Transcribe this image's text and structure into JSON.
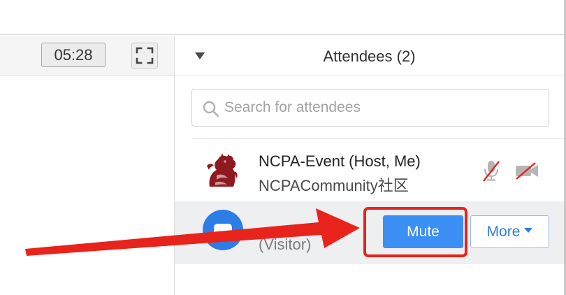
{
  "toolbar": {
    "timer": "05:28",
    "fullscreen_icon": "fullscreen-icon"
  },
  "attendees": {
    "collapse_icon": "triangle-down-icon",
    "title": "Attendees (2)",
    "search": {
      "placeholder": "Search for attendees",
      "value": "",
      "icon": "search-icon"
    },
    "list": [
      {
        "name": "NCPA-Event (Host, Me)",
        "subtitle": "NCPACommunity社区",
        "avatar": "dragon-avatar",
        "mic": "mic-muted-icon",
        "camera": "camera-off-icon"
      },
      {
        "name": "(Visitor)",
        "avatar": "blue-avatar",
        "actions": {
          "mute_label": "Mute",
          "more_label": "More",
          "more_icon": "caret-down-icon"
        }
      }
    ]
  },
  "annotation": {
    "arrow_color": "#e8231b",
    "highlight_color": "#e8231b",
    "highlight_target": "Mute"
  },
  "colors": {
    "mute_button": "#3b8ff5",
    "more_text": "#2f7de0",
    "selected_row": "#eeeff1",
    "muted_icon_slash": "#e8231b"
  }
}
